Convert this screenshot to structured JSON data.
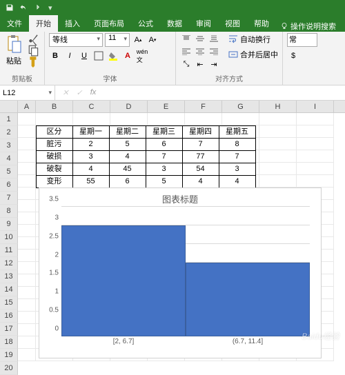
{
  "titlebar": {
    "save_icon": "save",
    "undo_icon": "undo",
    "redo_icon": "redo"
  },
  "tabs": {
    "file": "文件",
    "home": "开始",
    "insert": "插入",
    "layout": "页面布局",
    "formulas": "公式",
    "data": "数据",
    "review": "审阅",
    "view": "视图",
    "help": "帮助",
    "tell_me": "操作说明搜索"
  },
  "ribbon": {
    "clipboard": {
      "paste": "粘贴",
      "label": "剪贴板"
    },
    "font": {
      "name": "等线",
      "size": "11",
      "label": "字体",
      "bold": "B",
      "italic": "I",
      "underline": "U"
    },
    "alignment": {
      "wrap": "自动换行",
      "merge": "合并后居中",
      "label": "对齐方式"
    },
    "number": {
      "general": "常",
      "currency": "$"
    }
  },
  "namebox": {
    "ref": "L12"
  },
  "columns": [
    "A",
    "B",
    "C",
    "D",
    "E",
    "F",
    "G",
    "H",
    "I"
  ],
  "col_widths": {
    "A": 26,
    "other": 54
  },
  "row_count": 20,
  "table": {
    "headers": [
      "区分",
      "星期一",
      "星期二",
      "星期三",
      "星期四",
      "星期五"
    ],
    "rows": [
      [
        "脏污",
        "2",
        "5",
        "6",
        "7",
        "8"
      ],
      [
        "破损",
        "3",
        "4",
        "7",
        "77",
        "7"
      ],
      [
        "破裂",
        "4",
        "45",
        "3",
        "54",
        "3"
      ],
      [
        "变形",
        "55",
        "6",
        "5",
        "4",
        "4"
      ]
    ]
  },
  "chart_data": {
    "type": "bar",
    "title": "图表标题",
    "categories": [
      "[2, 6.7]",
      "(6.7, 11.4]"
    ],
    "values": [
      3,
      2
    ],
    "ylim": [
      0,
      3.5
    ],
    "yticks": [
      0,
      0.5,
      1,
      1.5,
      2,
      2.5,
      3,
      3.5
    ],
    "xlabel": "",
    "ylabel": ""
  },
  "watermark": "Baidu经验"
}
